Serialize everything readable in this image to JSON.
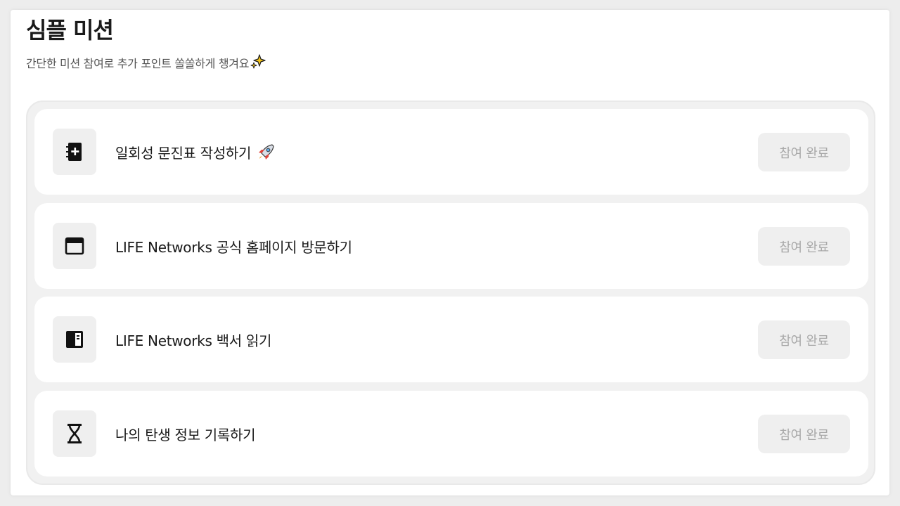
{
  "header": {
    "title": "심플 미션",
    "subtitle": "간단한 미션 참여로 추가 포인트 쏠쏠하게 챙겨요"
  },
  "missions": [
    {
      "icon": "notebook-plus-icon",
      "label": "일회성 문진표 작성하기",
      "emoji": "rocket-emoji",
      "button_label": "참여 완료"
    },
    {
      "icon": "browser-window-icon",
      "label": "LIFE Networks 공식 홈페이지 방문하기",
      "button_label": "참여 완료"
    },
    {
      "icon": "book-icon",
      "label": "LIFE Networks 백서 읽기",
      "button_label": "참여 완료"
    },
    {
      "icon": "hourglass-icon",
      "label": "나의 탄생 정보 기록하기",
      "button_label": "참여 완료"
    }
  ]
}
